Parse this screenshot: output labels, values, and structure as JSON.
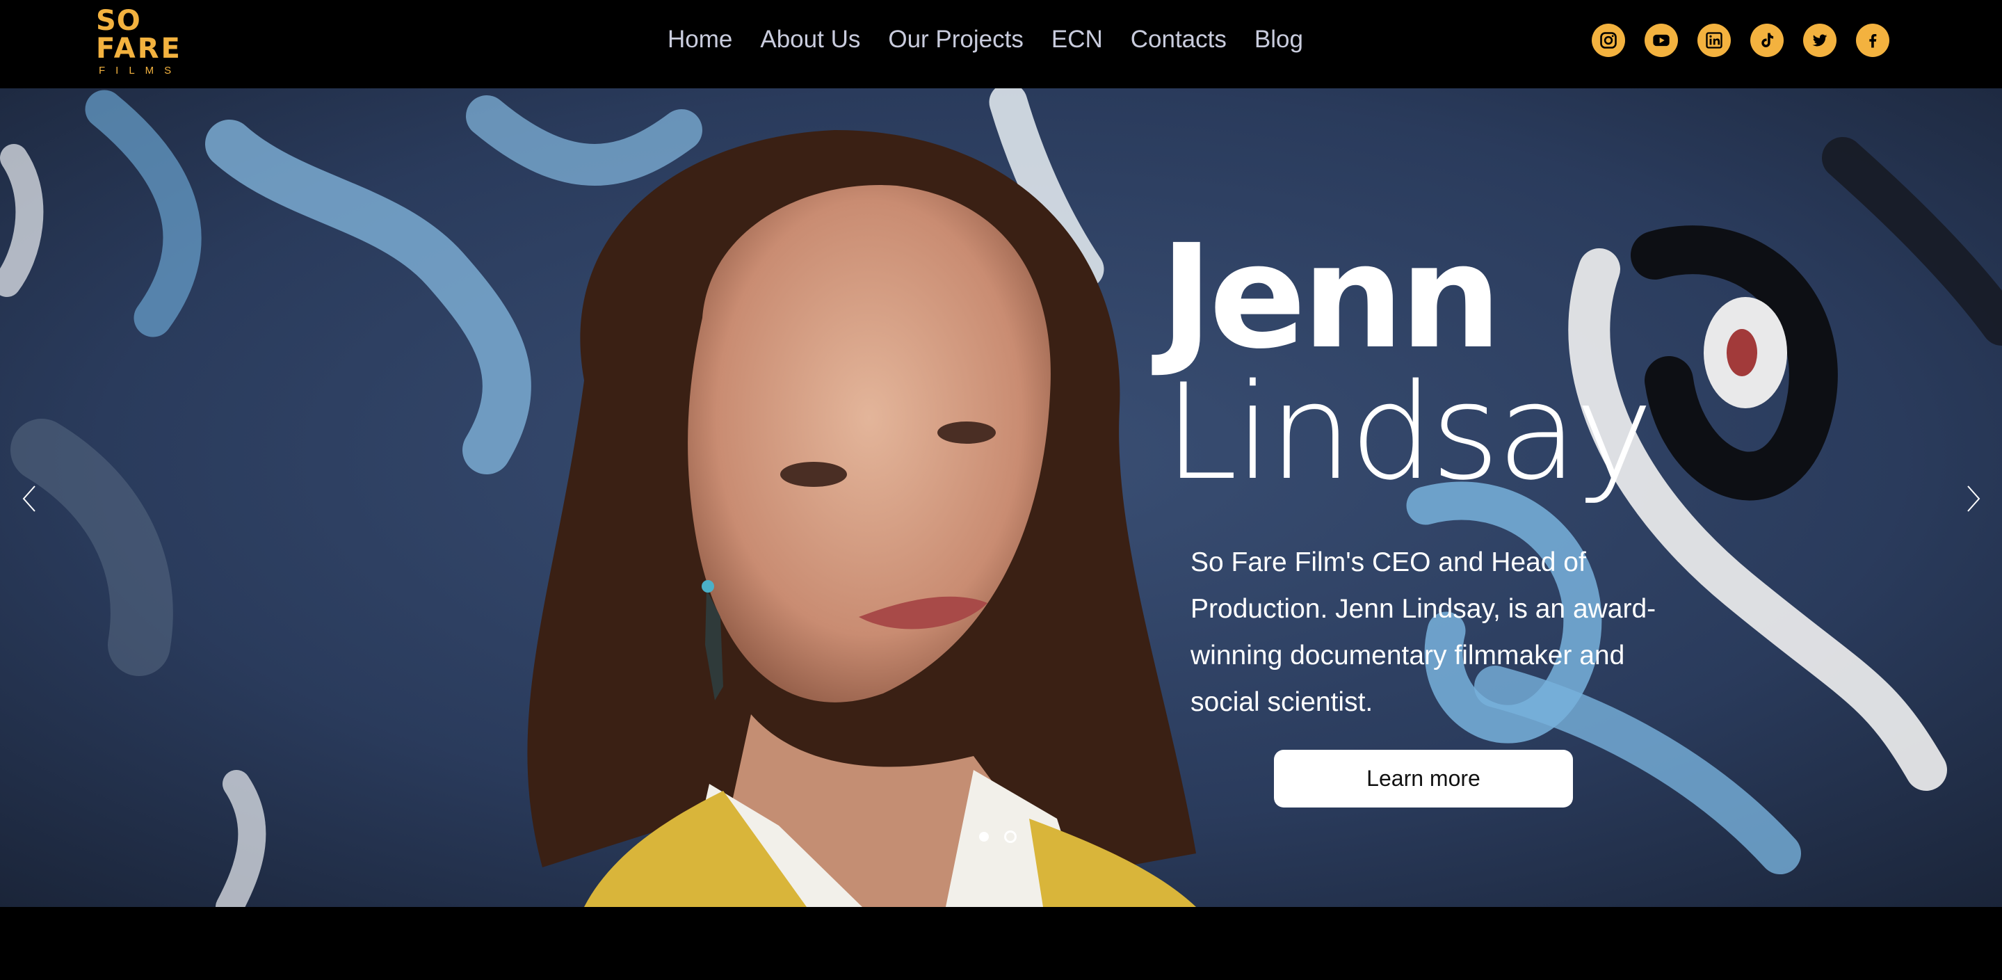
{
  "brand": {
    "logo_line1": "SO",
    "logo_line2": "FARE",
    "logo_line3": "FILMS",
    "accent_color": "#f3b23f"
  },
  "nav": {
    "items": [
      {
        "label": "Home"
      },
      {
        "label": "About Us"
      },
      {
        "label": "Our Projects"
      },
      {
        "label": "ECN"
      },
      {
        "label": "Contacts"
      },
      {
        "label": "Blog"
      }
    ]
  },
  "social": {
    "icons": [
      "instagram-icon",
      "youtube-icon",
      "linkedin-icon",
      "tiktok-icon",
      "twitter-icon",
      "facebook-icon"
    ]
  },
  "hero": {
    "title_first": "Jenn",
    "title_last": "Lindsay",
    "description": "So Fare Film's CEO and Head of Production. Jenn Lindsay, is an award-winning documentary filmmaker and social scientist.",
    "cta_label": "Learn more",
    "slide_count": 2,
    "active_slide": 1
  }
}
